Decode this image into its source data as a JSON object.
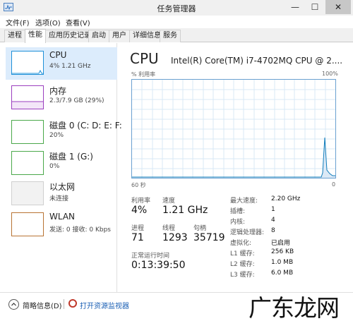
{
  "window": {
    "title": "任务管理器",
    "minimize": "—",
    "maximize": "☐",
    "close": "✕"
  },
  "menu": {
    "file": "文件(F)",
    "options": "选项(O)",
    "view": "查看(V)"
  },
  "tabs": [
    "进程",
    "性能",
    "应用历史记录",
    "启动",
    "用户",
    "详细信息",
    "服务"
  ],
  "active_tab": "性能",
  "sidebar": {
    "items": [
      {
        "name": "CPU",
        "detail": "4% 1.21 GHz",
        "color": "#1e90d8"
      },
      {
        "name": "内存",
        "detail": "2.3/7.9 GB (29%)",
        "color": "#9b3fbf"
      },
      {
        "name": "磁盘 0 (C: D: E: F:",
        "detail": "20%",
        "color": "#4aa84a"
      },
      {
        "name": "磁盘 1 (G:)",
        "detail": "0%",
        "color": "#4aa84a"
      },
      {
        "name": "以太网",
        "detail": "未连接",
        "color": "#aaaaaa"
      },
      {
        "name": "WLAN",
        "detail": "发送: 0 接收: 0 Kbps",
        "color": "#b87333"
      }
    ]
  },
  "cpu": {
    "title": "CPU",
    "model": "Intel(R) Core(TM) i7-4702MQ CPU @ 2....",
    "util_label": "% 利用率",
    "max_label": "100%",
    "time_label": "60 秒",
    "zero_label": "0",
    "graph_color": "#117dbb",
    "stats": {
      "utilization_label": "利用率",
      "utilization": "4%",
      "speed_label": "速度",
      "speed": "1.21 GHz",
      "processes_label": "进程",
      "processes": "71",
      "threads_label": "线程",
      "threads": "1293",
      "handles_label": "句柄",
      "handles": "35719",
      "uptime_label": "正常运行时间",
      "uptime": "0:13:39:50"
    },
    "specs": [
      {
        "k": "最大速度:",
        "v": "2.20 GHz"
      },
      {
        "k": "插槽:",
        "v": "1"
      },
      {
        "k": "内核:",
        "v": "4"
      },
      {
        "k": "逻辑处理器:",
        "v": "8"
      },
      {
        "k": "虚拟化:",
        "v": "已启用"
      },
      {
        "k": "L1 缓存:",
        "v": "256 KB"
      },
      {
        "k": "L2 缓存:",
        "v": "1.0 MB"
      },
      {
        "k": "L3 缓存:",
        "v": "6.0 MB"
      }
    ]
  },
  "footer": {
    "summary": "简略信息(D)",
    "resource_monitor": "打开资源监视器"
  },
  "watermark": "广东龙网"
}
